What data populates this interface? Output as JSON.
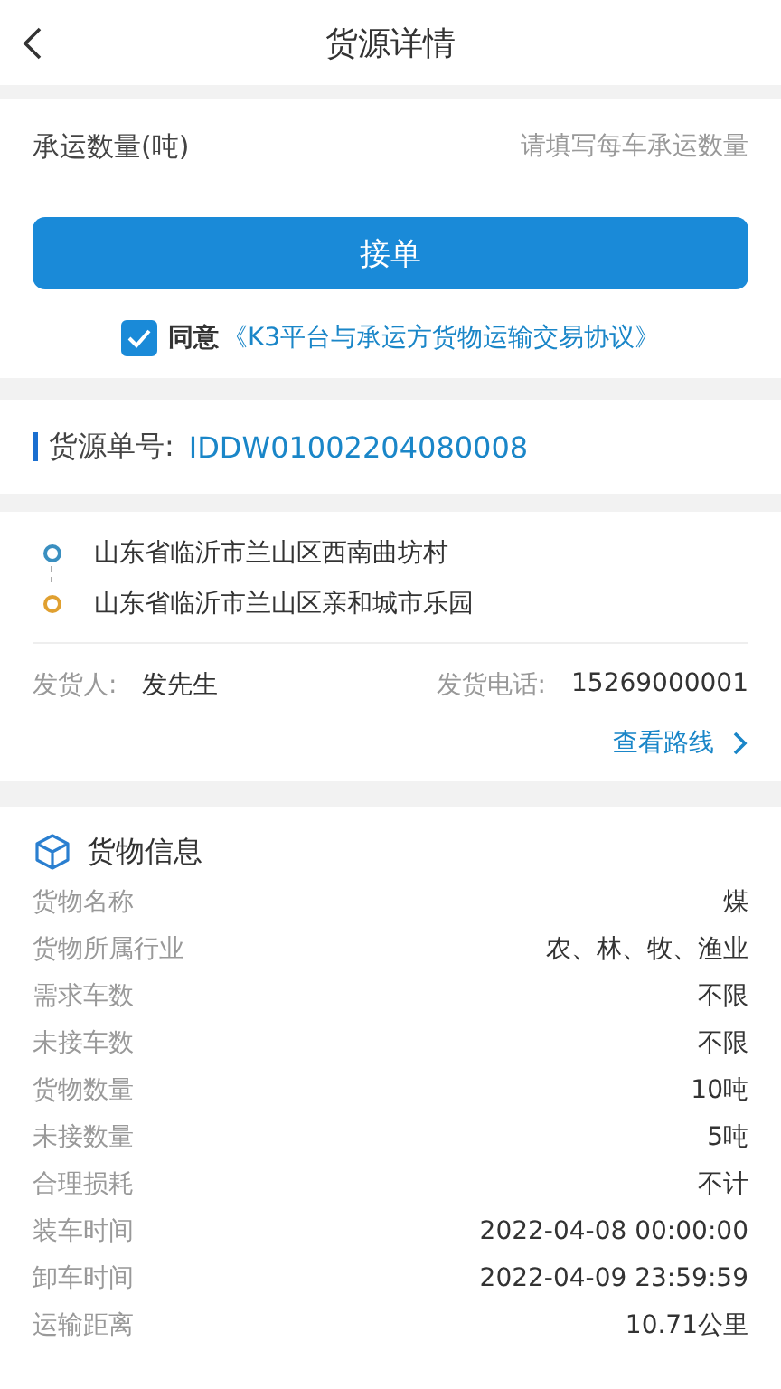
{
  "header": {
    "title": "货源详情"
  },
  "quantity": {
    "label": "承运数量(吨)",
    "placeholder": "请填写每车承运数量"
  },
  "accept_button": "接单",
  "agreement": {
    "checked": true,
    "text": "同意",
    "link": "《K3平台与承运方货物运输交易协议》"
  },
  "order": {
    "label": "货源单号:",
    "number": "IDDW01002204080008"
  },
  "route": {
    "stops": [
      {
        "color": "#3a8fc0",
        "address": "山东省临沂市兰山区西南曲坊村"
      },
      {
        "color": "#e0a030",
        "address": "山东省临沂市兰山区亲和城市乐园"
      }
    ],
    "shipper_label": "发货人:",
    "shipper": "发先生",
    "phone_label": "发货电话:",
    "phone": "15269000001",
    "view_route": "查看路线"
  },
  "goods": {
    "title": "货物信息",
    "rows": [
      {
        "label": "货物名称",
        "value": "煤"
      },
      {
        "label": "货物所属行业",
        "value": "农、林、牧、渔业"
      },
      {
        "label": "需求车数",
        "value": "不限"
      },
      {
        "label": "未接车数",
        "value": "不限"
      },
      {
        "label": "货物数量",
        "value": "10吨"
      },
      {
        "label": "未接数量",
        "value": "5吨"
      },
      {
        "label": "合理损耗",
        "value": "不计"
      },
      {
        "label": "装车时间",
        "value": "2022-04-08 00:00:00"
      },
      {
        "label": "卸车时间",
        "value": "2022-04-09 23:59:59"
      },
      {
        "label": "运输距离",
        "value": "10.71公里"
      }
    ]
  }
}
